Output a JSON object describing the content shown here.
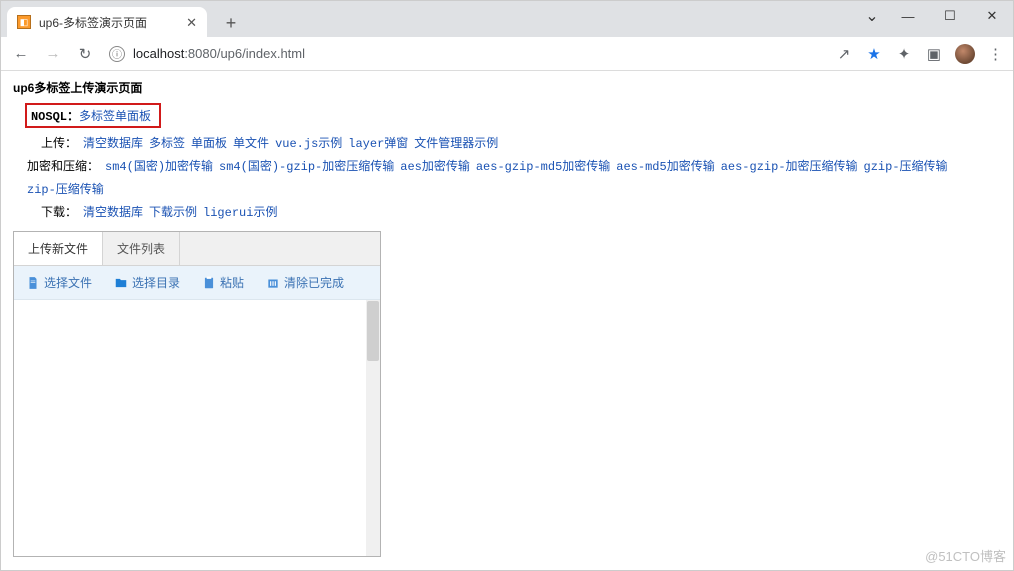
{
  "window": {
    "tab_title": "up6-多标签演示页面",
    "chevron": "⌄",
    "minimize": "—",
    "maximize": "☐",
    "close": "✕"
  },
  "toolbar": {
    "back": "←",
    "forward": "→",
    "reload": "↻",
    "info": "ⓘ",
    "url_host": "localhost",
    "url_portpath": ":8080/up6/index.html",
    "share": "↗",
    "star": "★",
    "puzzle": "✦",
    "square": "▣",
    "kebab": "⋮"
  },
  "page": {
    "title": "up6多标签上传演示页面",
    "rows": {
      "nosql": {
        "label": "NOSQL：",
        "links": [
          "多标签",
          "单面板"
        ]
      },
      "upload": {
        "label": "上传：",
        "links": [
          "清空数据库",
          "多标签",
          "单面板",
          "单文件",
          "vue.js示例",
          "layer弹窗",
          "文件管理器示例"
        ]
      },
      "encrypt": {
        "label": "加密和压缩：",
        "links": [
          "sm4(国密)加密传输",
          "sm4(国密)-gzip-加密压缩传输",
          "aes加密传输",
          "aes-gzip-md5加密传输",
          "aes-md5加密传输",
          "aes-gzip-加密压缩传输",
          "gzip-压缩传输",
          "zip-压缩传输"
        ]
      },
      "download": {
        "label": "下载：",
        "links": [
          "清空数据库",
          "下载示例",
          "ligerui示例"
        ]
      }
    }
  },
  "panel": {
    "tabs": {
      "t1": "上传新文件",
      "t2": "文件列表"
    },
    "actions": {
      "select_file": "选择文件",
      "select_dir": "选择目录",
      "paste": "粘贴",
      "clear": "清除已完成"
    }
  },
  "watermark": "@51CTO博客"
}
